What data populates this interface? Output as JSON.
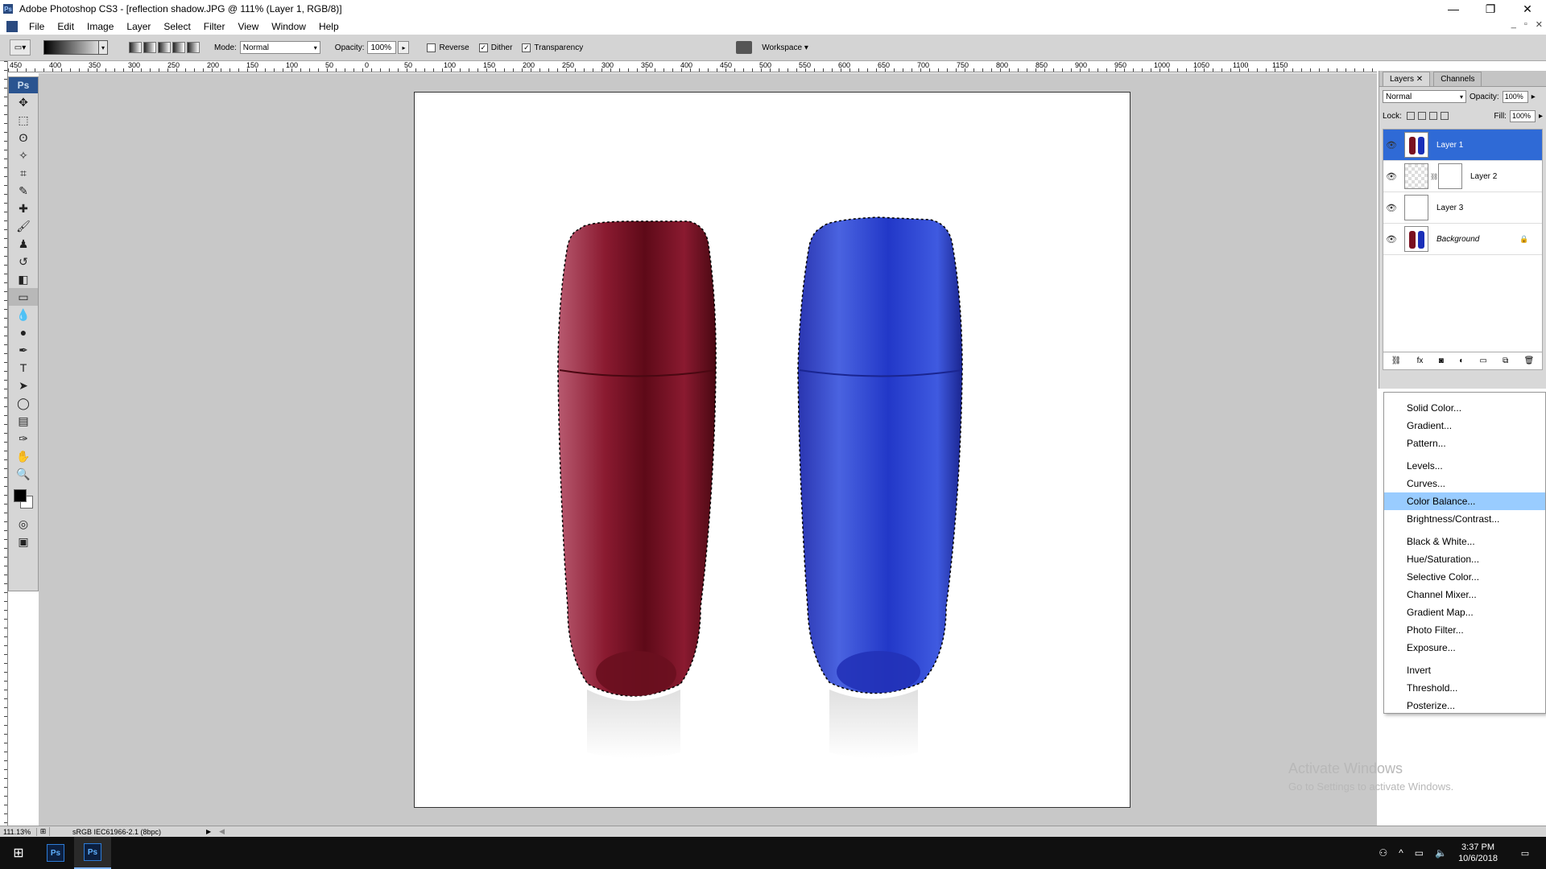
{
  "window": {
    "title": "Adobe Photoshop CS3 - [reflection shadow.JPG @ 111% (Layer 1, RGB/8)]",
    "minimize": "—",
    "maximize": "❐",
    "close": "✕"
  },
  "menu": [
    "File",
    "Edit",
    "Image",
    "Layer",
    "Select",
    "Filter",
    "View",
    "Window",
    "Help"
  ],
  "options": {
    "mode_label": "Mode:",
    "mode_value": "Normal",
    "opacity_label": "Opacity:",
    "opacity_value": "100%",
    "reverse_label": "Reverse",
    "reverse_checked": false,
    "dither_label": "Dither",
    "dither_checked": true,
    "transparency_label": "Transparency",
    "transparency_checked": true,
    "workspace_label": "Workspace"
  },
  "ruler_labels": [
    "450",
    "400",
    "350",
    "300",
    "250",
    "200",
    "150",
    "100",
    "50",
    "0",
    "50",
    "100",
    "150",
    "200",
    "250",
    "300",
    "350",
    "400",
    "450",
    "500",
    "550",
    "600",
    "650",
    "700",
    "750",
    "800",
    "850",
    "900",
    "950",
    "1000",
    "1050",
    "1100",
    "1150"
  ],
  "toolbox": {
    "logo": "Ps",
    "tools": [
      {
        "name": "move-tool-icon",
        "glyph": "✥"
      },
      {
        "name": "marquee-tool-icon",
        "glyph": "⬚"
      },
      {
        "name": "lasso-tool-icon",
        "glyph": "ʘ"
      },
      {
        "name": "magic-wand-tool-icon",
        "glyph": "✧"
      },
      {
        "name": "crop-tool-icon",
        "glyph": "⌗"
      },
      {
        "name": "slice-tool-icon",
        "glyph": "✎"
      },
      {
        "name": "healing-brush-tool-icon",
        "glyph": "✚"
      },
      {
        "name": "brush-tool-icon",
        "glyph": "🖌"
      },
      {
        "name": "clone-stamp-tool-icon",
        "glyph": "♟"
      },
      {
        "name": "history-brush-tool-icon",
        "glyph": "↺"
      },
      {
        "name": "eraser-tool-icon",
        "glyph": "◧"
      },
      {
        "name": "gradient-tool-icon",
        "glyph": "▭"
      },
      {
        "name": "blur-tool-icon",
        "glyph": "💧"
      },
      {
        "name": "dodge-tool-icon",
        "glyph": "●"
      },
      {
        "name": "pen-tool-icon",
        "glyph": "✒"
      },
      {
        "name": "type-tool-icon",
        "glyph": "T"
      },
      {
        "name": "path-selection-tool-icon",
        "glyph": "➤"
      },
      {
        "name": "shape-tool-icon",
        "glyph": "◯"
      },
      {
        "name": "notes-tool-icon",
        "glyph": "▤"
      },
      {
        "name": "eyedropper-tool-icon",
        "glyph": "✑"
      },
      {
        "name": "hand-tool-icon",
        "glyph": "✋"
      },
      {
        "name": "zoom-tool-icon",
        "glyph": "🔍"
      }
    ],
    "active_tool": "gradient-tool-icon"
  },
  "layers_panel": {
    "tabs": [
      "Layers",
      "Channels"
    ],
    "blend_mode": "Normal",
    "opacity_label": "Opacity:",
    "opacity_value": "100%",
    "lock_label": "Lock:",
    "fill_label": "Fill:",
    "fill_value": "100%",
    "layers": [
      {
        "name": "Layer 1",
        "selected": true,
        "thumb": "bottles",
        "italic": false,
        "locked": false,
        "mask": false
      },
      {
        "name": "Layer 2",
        "selected": false,
        "thumb": "checker",
        "italic": false,
        "locked": false,
        "mask": true
      },
      {
        "name": "Layer 3",
        "selected": false,
        "thumb": "white",
        "italic": false,
        "locked": false,
        "mask": false
      },
      {
        "name": "Background",
        "selected": false,
        "thumb": "bottles",
        "italic": true,
        "locked": true,
        "mask": false
      }
    ]
  },
  "adjustment_menu": {
    "groups": [
      [
        "Solid Color...",
        "Gradient...",
        "Pattern..."
      ],
      [
        "Levels...",
        "Curves...",
        "Color Balance...",
        "Brightness/Contrast..."
      ],
      [
        "Black & White...",
        "Hue/Saturation...",
        "Selective Color...",
        "Channel Mixer...",
        "Gradient Map...",
        "Photo Filter...",
        "Exposure..."
      ],
      [
        "Invert",
        "Threshold...",
        "Posterize..."
      ]
    ],
    "highlighted": "Color Balance..."
  },
  "watermark": {
    "line1": "Activate Windows",
    "line2": "Go to Settings to activate Windows."
  },
  "statusbar": {
    "zoom": "111.13%",
    "profile": "sRGB IEC61966-2.1 (8bpc)"
  },
  "taskbar": {
    "time": "3:37 PM",
    "date": "10/6/2018",
    "app_label": "Ps"
  },
  "colors": {
    "selection_blue": "#2f6ad6",
    "menu_highlight": "#99ccff",
    "bottle_red": "#7a1020",
    "bottle_blue": "#1a2fb8"
  }
}
